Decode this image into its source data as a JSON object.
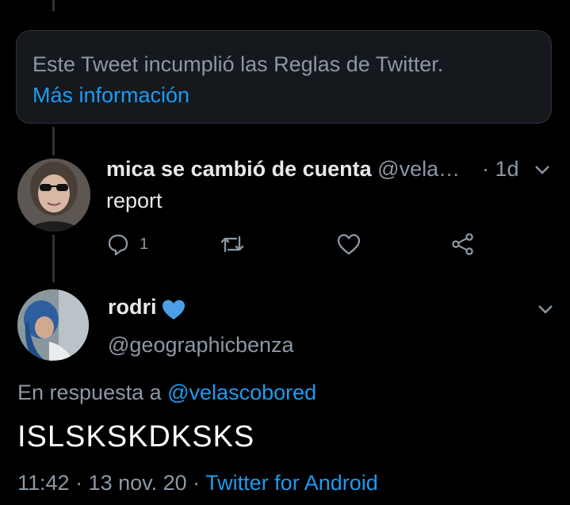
{
  "notice": {
    "text": "Este Tweet incumplió las Reglas de Twitter.",
    "link": "Más información"
  },
  "tweet1": {
    "display_name": "mica se cambió de cuenta",
    "handle": "@vela…",
    "time": "· 1d",
    "body": "report",
    "reply_count": "1"
  },
  "tweet2": {
    "display_name": "rodri",
    "handle": "@geographicbenza",
    "reply_prefix": "En respuesta a ",
    "reply_handle": "@velascobored",
    "body": "ISLSKSKDKSKS",
    "timestamp": "11:42 · 13 nov. 20 · ",
    "source": "Twitter for Android"
  },
  "colors": {
    "accent": "#1d9bf0",
    "secondary_text": "#8b98a5",
    "verified_heart": "#4a9fe8"
  },
  "icons": [
    "reply-icon",
    "retweet-icon",
    "like-icon",
    "share-icon",
    "chevron-down-icon",
    "blue-heart-icon"
  ]
}
